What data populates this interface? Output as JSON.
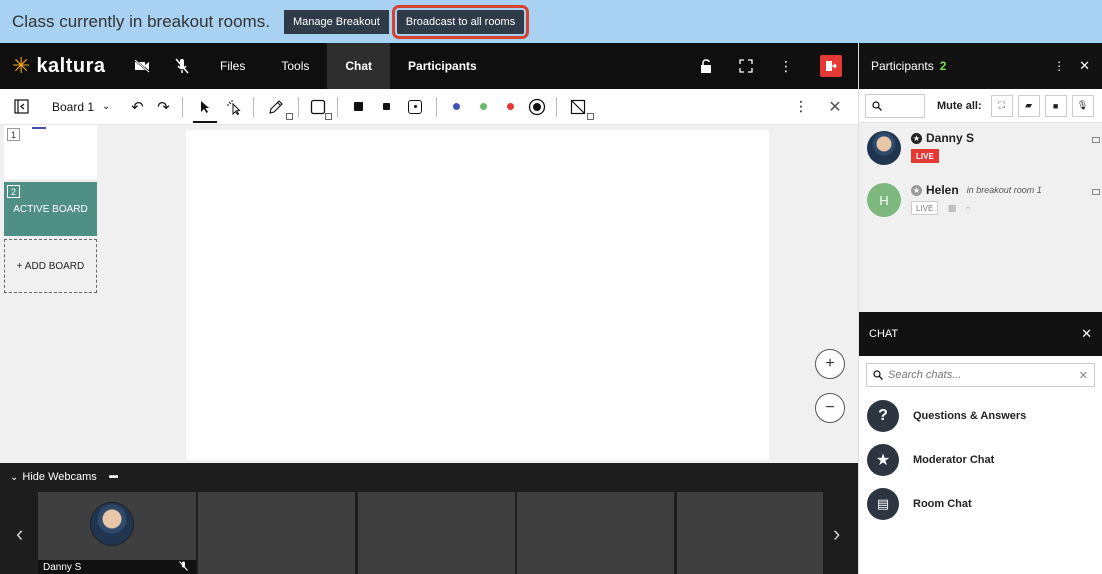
{
  "banner": {
    "text": "Class currently in breakout rooms.",
    "manage_label": "Manage Breakout",
    "broadcast_label": "Broadcast to all rooms"
  },
  "header": {
    "logo_text": "kaltura",
    "tabs": [
      {
        "label": "Files"
      },
      {
        "label": "Tools"
      },
      {
        "label": "Chat"
      },
      {
        "label": "Participants"
      }
    ]
  },
  "toolbar": {
    "board_label": "Board 1",
    "colors": [
      "#3f51b5",
      "#66bb6a",
      "#e53935"
    ]
  },
  "boards": {
    "thumb1_num": "1",
    "thumb2_num": "2",
    "active_label": "ACTIVE BOARD",
    "add_label": "+ ADD BOARD"
  },
  "zoom": {
    "in": "+",
    "out": "−"
  },
  "webcams": {
    "hide_label": "Hide Webcams",
    "cam_name": "Danny S"
  },
  "participants_panel": {
    "title": "Participants",
    "count": "2",
    "mute_label": "Mute all:",
    "people": [
      {
        "name": "Danny S",
        "status": "LIVE"
      },
      {
        "name": "Helen",
        "initial": "H",
        "room": "in breakout room 1",
        "status": "LIVE"
      }
    ]
  },
  "chat_panel": {
    "title": "CHAT",
    "search_placeholder": "Search chats...",
    "items": [
      {
        "label": "Questions & Answers",
        "icon": "?"
      },
      {
        "label": "Moderator Chat",
        "icon": "★"
      },
      {
        "label": "Room Chat",
        "icon": "▤"
      }
    ]
  }
}
